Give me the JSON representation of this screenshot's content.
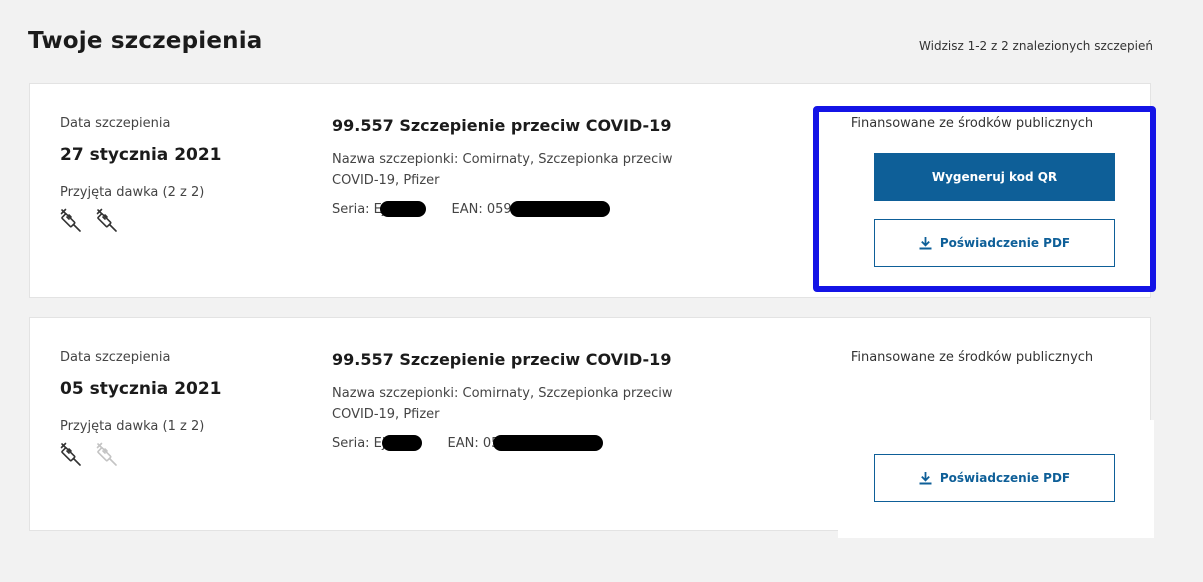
{
  "header": {
    "title": "Twoje szczepienia",
    "result_count": "Widzisz 1-2 z 2 znalezionych szczepień"
  },
  "vaccinations": [
    {
      "date_label": "Data szczepienia",
      "date": "27 stycznia 2021",
      "dose_label": "Przyjęta dawka (2 z 2)",
      "doses_received": 2,
      "doses_total": 2,
      "title": "99.557 Szczepienie przeciw COVID-19",
      "vaccine_name": "Nazwa szczepionki: Comirnaty, Szczepionka przeciw COVID-19, Pfizer",
      "series_label": "Seria: Ej",
      "ean_label": "EAN: 059",
      "funding": "Finansowane ze środków publicznych",
      "qr_button": "Wygeneruj kod QR",
      "pdf_button": "Poświadczenie PDF"
    },
    {
      "date_label": "Data szczepienia",
      "date": "05 stycznia 2021",
      "dose_label": "Przyjęta dawka (1 z 2)",
      "doses_received": 1,
      "doses_total": 2,
      "title": "99.557 Szczepienie przeciw COVID-19",
      "vaccine_name": "Nazwa szczepionki: Comirnaty, Szczepionka przeciw COVID-19, Pfizer",
      "series_label": "Seria: Ej",
      "ean_label": "EAN: 05",
      "funding": "Finansowane ze środków publicznych",
      "pdf_button": "Poświadczenie PDF"
    }
  ],
  "icons": {
    "syringe": "syringe-icon",
    "download": "download-icon"
  },
  "colors": {
    "primary": "#0e5f98",
    "highlight": "#1414e6",
    "syringe_active": "#333333",
    "syringe_inactive": "#c4c4c4"
  }
}
